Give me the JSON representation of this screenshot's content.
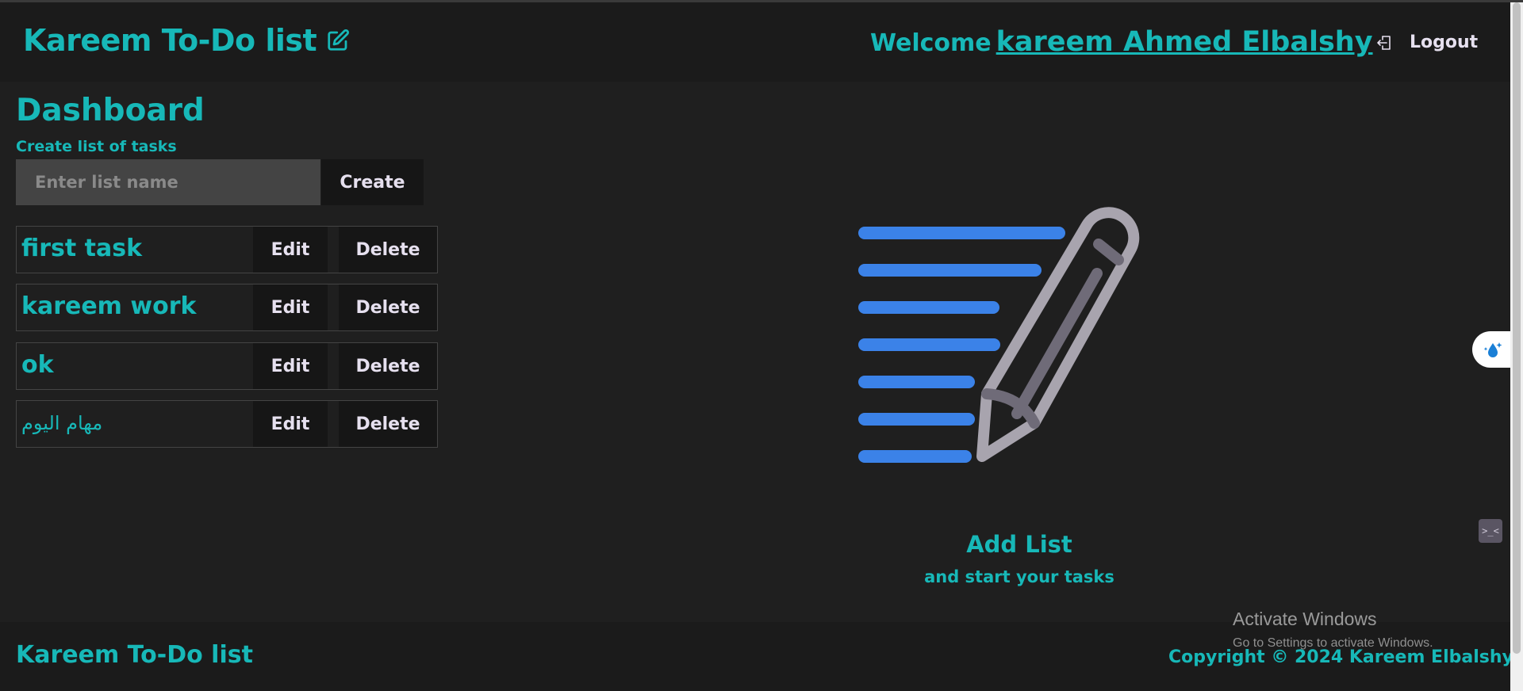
{
  "header": {
    "brand_title": "Kareem To-Do list",
    "welcome_text": "Welcome",
    "user_name": "kareem Ahmed Elbalshy",
    "logout_label": "Logout"
  },
  "dashboard": {
    "title": "Dashboard",
    "create_label": "Create list of tasks",
    "input_placeholder": "Enter list name",
    "input_value": "",
    "create_button": "Create"
  },
  "lists": [
    {
      "name": "first task",
      "edit": "Edit",
      "delete": "Delete"
    },
    {
      "name": "kareem work",
      "edit": "Edit",
      "delete": "Delete"
    },
    {
      "name": "ok",
      "edit": "Edit",
      "delete": "Delete"
    },
    {
      "name": "مهام اليوم",
      "edit": "Edit",
      "delete": "Delete"
    }
  ],
  "empty_state": {
    "title": "Add List",
    "subtitle": "and start your tasks",
    "icon": "notes-pencil-icon"
  },
  "footer": {
    "brand": "Kareem To-Do list",
    "copyright": "Copyright © 2024 Kareem Elbalshy"
  },
  "os_watermark": {
    "line1": "Activate Windows",
    "line2": "Go to Settings to activate Windows."
  },
  "colors": {
    "accent": "#17b8b8",
    "background": "#1f1f1f",
    "button_bg": "#161616",
    "button_text": "#e6e0ef",
    "illustration_lines": "#3b82e8"
  }
}
